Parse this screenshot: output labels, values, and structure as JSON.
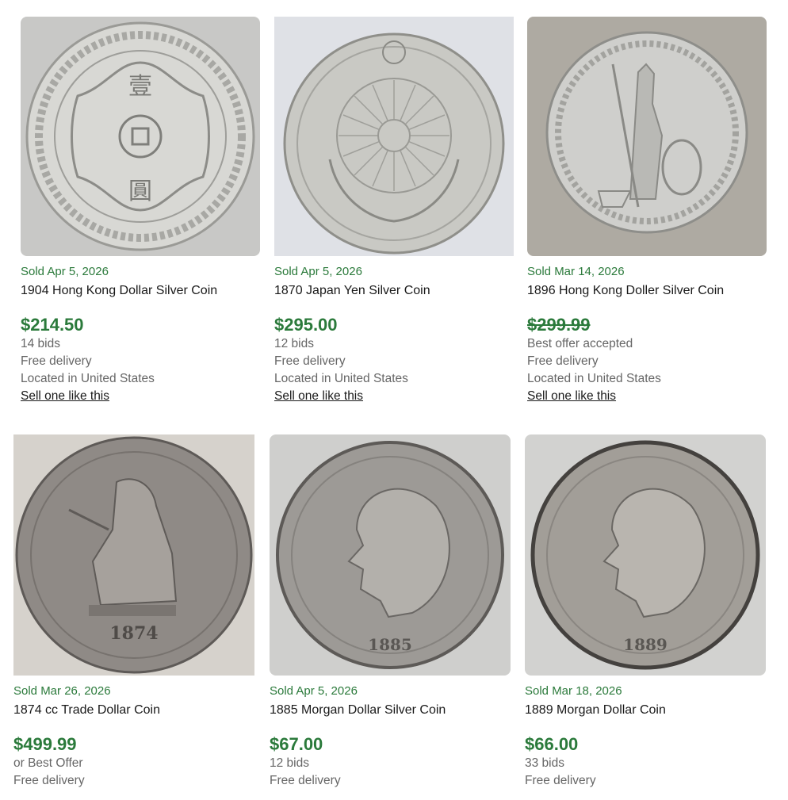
{
  "listings": [
    {
      "sold_date": "Sold Apr 5, 2026",
      "title": "1904 Hong Kong Dollar Silver Coin",
      "price": "$214.50",
      "price_struck": false,
      "details": [
        "14 bids",
        "Free delivery",
        "Located in United States"
      ],
      "sell_link": "Sell one like this",
      "image_icon": "hong-kong-dollar-coin-icon",
      "bg": "#c8c8c6",
      "coin": "#d8d8d4"
    },
    {
      "sold_date": "Sold Apr 5, 2026",
      "title": "1870 Japan Yen Silver Coin",
      "price": "$295.00",
      "price_struck": false,
      "details": [
        "12 bids",
        "Free delivery",
        "Located in United States"
      ],
      "sell_link": "Sell one like this",
      "image_icon": "japan-yen-coin-icon",
      "bg": "#dfe1e6",
      "coin": "#c9c9c4"
    },
    {
      "sold_date": "Sold Mar 14, 2026",
      "title": "1896 Hong Kong Doller Silver Coin",
      "price": "$299.99",
      "price_struck": true,
      "details": [
        "Best offer accepted",
        "Free delivery",
        "Located in United States"
      ],
      "sell_link": "Sell one like this",
      "image_icon": "britannia-trade-dollar-coin-icon",
      "bg": "#aeaaa2",
      "coin": "#cfcfcc"
    },
    {
      "sold_date": "Sold Mar 26, 2026",
      "title": "1874 cc Trade Dollar Coin",
      "price": "$499.99",
      "price_struck": false,
      "details": [
        "or Best Offer",
        "Free delivery"
      ],
      "image_icon": "seated-liberty-trade-dollar-coin-icon",
      "bg": "#d6d2cc",
      "coin": "#8f8a86"
    },
    {
      "sold_date": "Sold Apr 5, 2026",
      "title": "1885 Morgan Dollar Silver Coin",
      "price": "$67.00",
      "price_struck": false,
      "details": [
        "12 bids",
        "Free delivery"
      ],
      "image_icon": "morgan-dollar-coin-icon",
      "bg": "#cfcfcd",
      "coin": "#9d9a96"
    },
    {
      "sold_date": "Sold Mar 18, 2026",
      "title": "1889 Morgan Dollar Coin",
      "price": "$66.00",
      "price_struck": false,
      "details": [
        "33 bids",
        "Free delivery"
      ],
      "image_icon": "morgan-dollar-coin-icon",
      "bg": "#d2d2d0",
      "coin": "#a29e98"
    }
  ]
}
